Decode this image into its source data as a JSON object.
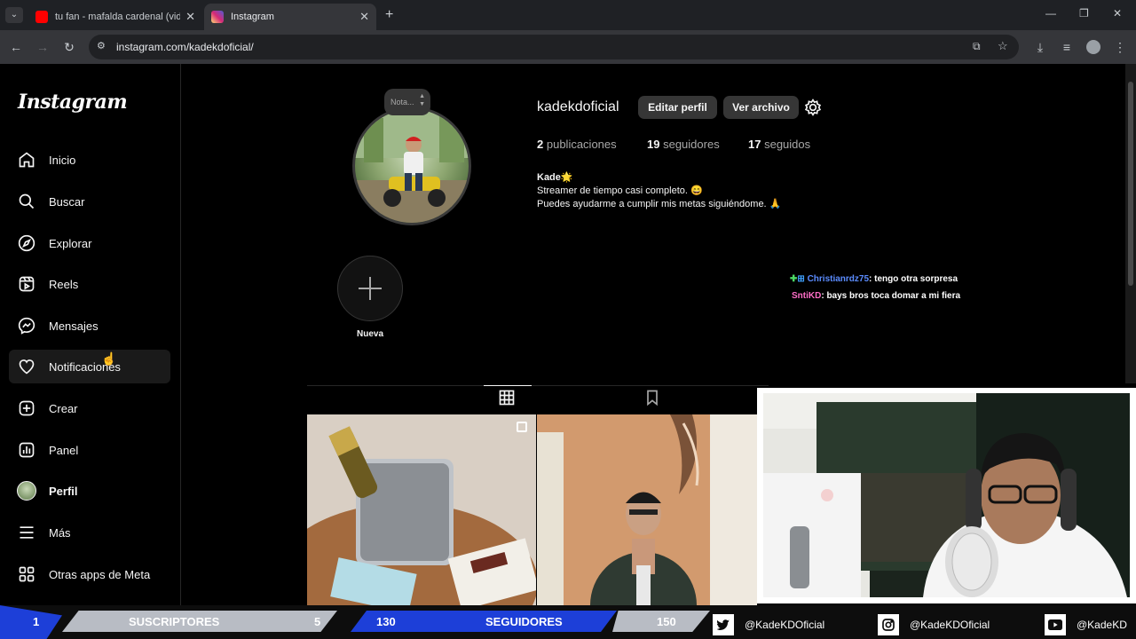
{
  "browser": {
    "tabs": [
      {
        "title": "tu fan - mafalda cardenal (video",
        "favicon_color": "#ff0000",
        "active": false
      },
      {
        "title": "Instagram",
        "favicon_color": "#d6249f",
        "active": true
      }
    ],
    "new_tab": "+",
    "url": "instagram.com/kadekdoficial/"
  },
  "sidebar": {
    "logo": "Instagram",
    "items": [
      {
        "label": "Inicio",
        "icon": "home-icon"
      },
      {
        "label": "Buscar",
        "icon": "search-icon"
      },
      {
        "label": "Explorar",
        "icon": "compass-icon"
      },
      {
        "label": "Reels",
        "icon": "reels-icon"
      },
      {
        "label": "Mensajes",
        "icon": "messenger-icon"
      },
      {
        "label": "Notificaciones",
        "icon": "heart-icon"
      },
      {
        "label": "Crear",
        "icon": "plus-square-icon"
      },
      {
        "label": "Panel",
        "icon": "chart-icon"
      },
      {
        "label": "Perfil",
        "icon": "avatar"
      },
      {
        "label": "Más",
        "icon": "menu-icon"
      },
      {
        "label": "Otras apps de Meta",
        "icon": "meta-apps-icon"
      }
    ]
  },
  "profile": {
    "note": "Nota...",
    "username": "kadekdoficial",
    "edit_button": "Editar perfil",
    "archive_button": "Ver archivo",
    "stats": {
      "posts_count": "2",
      "posts_label": "publicaciones",
      "followers_count": "19",
      "followers_label": "seguidores",
      "following_count": "17",
      "following_label": "seguidos"
    },
    "bio": {
      "name": "Kade🌟",
      "line1": "Streamer de tiempo casi completo. 😄",
      "line2": "Puedes ayudarme a cumplir mis metas siguiéndome. 🙏"
    },
    "highlight_new": "Nueva"
  },
  "overlay_chat": [
    {
      "user": "Christianrdz75",
      "message": ": tengo otra sorpresa",
      "user_color": "#5b8cff"
    },
    {
      "user": "SntiKD",
      "message": ": bays bros toca domar a mi fiera",
      "user_color": "#ff6ec7"
    }
  ],
  "stream_bar": {
    "subs_current": "1",
    "subs_label": "SUSCRIPTORES",
    "subs_goal": "5",
    "followers_current": "130",
    "followers_label": "SEGUIDORES",
    "followers_goal": "150",
    "twitter": "@KadeKDOficial",
    "instagram": "@KadeKDOficial",
    "youtube": "@KadeKD"
  },
  "colors": {
    "accent_blue": "#1d3fd8",
    "ig_bg": "#000000"
  }
}
